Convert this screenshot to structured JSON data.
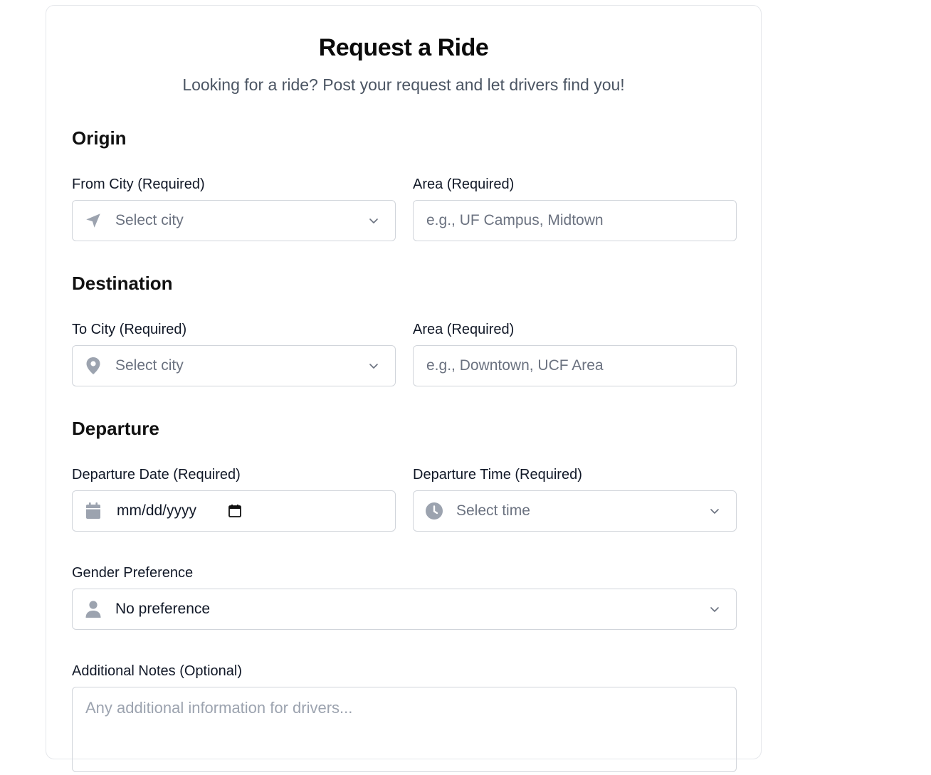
{
  "header": {
    "title": "Request a Ride",
    "subtitle": "Looking for a ride? Post your request and let drivers find you!"
  },
  "origin": {
    "section_title": "Origin",
    "city_label": "From City (Required)",
    "city_placeholder": "Select city",
    "city_icon": "navigation-arrow-icon",
    "area_label": "Area (Required)",
    "area_placeholder": "e.g., UF Campus, Midtown"
  },
  "destination": {
    "section_title": "Destination",
    "city_label": "To City (Required)",
    "city_placeholder": "Select city",
    "city_icon": "map-pin-icon",
    "area_label": "Area (Required)",
    "area_placeholder": "e.g., Downtown, UCF Area"
  },
  "departure": {
    "section_title": "Departure",
    "date_label": "Departure Date (Required)",
    "date_placeholder": "mm/dd/yyyy",
    "date_icon": "calendar-icon",
    "time_label": "Departure Time (Required)",
    "time_placeholder": "Select time",
    "time_icon": "clock-icon"
  },
  "gender": {
    "label": "Gender Preference",
    "value": "No preference",
    "icon": "user-icon"
  },
  "notes": {
    "label": "Additional Notes (Optional)",
    "placeholder": "Any additional information for drivers..."
  },
  "colors": {
    "icon_gray": "#9ca3af",
    "border": "#d1d5db",
    "placeholder": "#6b7280"
  }
}
